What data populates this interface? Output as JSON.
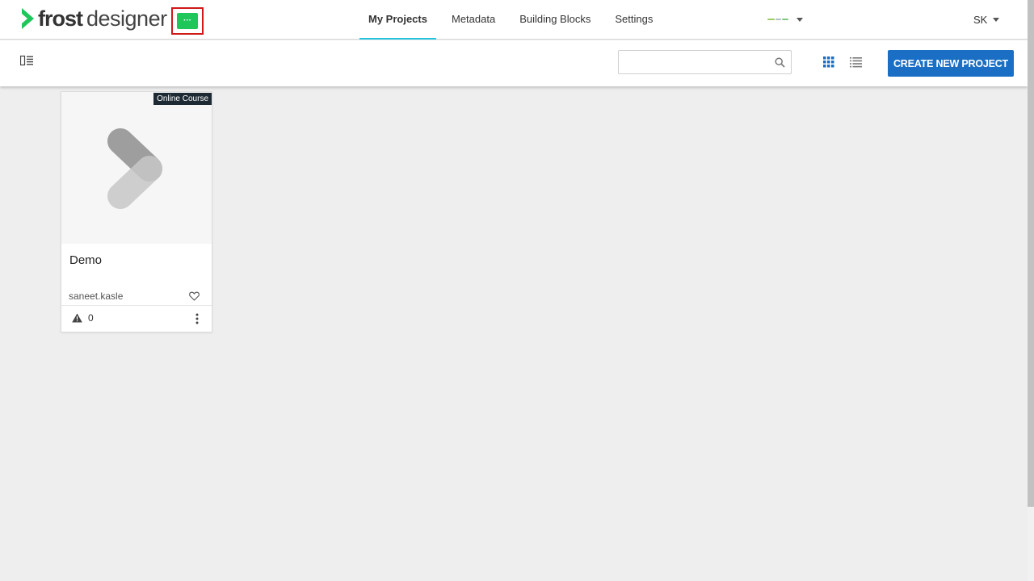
{
  "app": {
    "logo_bold": "frost",
    "logo_light": "designer",
    "badge_label": "···"
  },
  "nav": {
    "items": [
      {
        "label": "My Projects",
        "active": true
      },
      {
        "label": "Metadata"
      },
      {
        "label": "Building Blocks"
      },
      {
        "label": "Settings"
      }
    ]
  },
  "user": {
    "initials": "SK"
  },
  "toolbar": {
    "search_placeholder": "",
    "search_value": "",
    "create_label": "CREATE NEW PROJECT"
  },
  "projects": [
    {
      "type": "Online Course",
      "title": "Demo",
      "owner": "saneet.kasle",
      "warnings": "0"
    }
  ],
  "colors": {
    "accent": "#1a6fc4",
    "tab_underline": "#27c2dc",
    "brand_green": "#1fc75a",
    "highlight_box": "#d01818"
  },
  "icons": [
    "logo-chevron-icon",
    "panel-toggle-icon",
    "search-icon",
    "grid-view-icon",
    "list-view-icon",
    "heart-icon",
    "warning-icon",
    "more-vertical-icon",
    "chevron-down-icon"
  ]
}
